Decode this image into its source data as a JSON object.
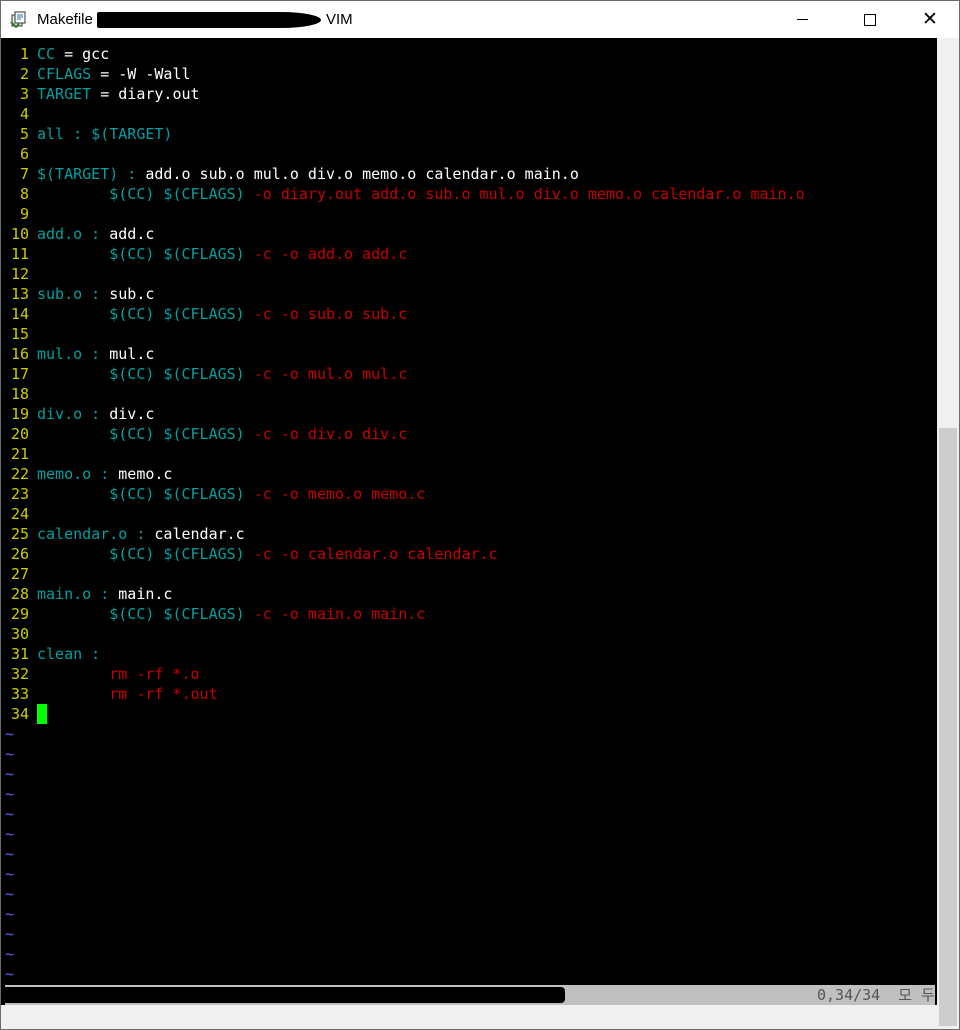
{
  "window": {
    "title": "Makefile",
    "title_suffix": "VIM",
    "controls": {
      "minimize": "—",
      "maximize": "☐",
      "close": "✕"
    }
  },
  "editor": {
    "lines": [
      {
        "n": "1",
        "segs": [
          {
            "t": "CC",
            "c": "cyan"
          },
          {
            "t": " = gcc",
            "c": "white"
          }
        ]
      },
      {
        "n": "2",
        "segs": [
          {
            "t": "CFLAGS",
            "c": "cyan"
          },
          {
            "t": " = -W -Wall",
            "c": "white"
          }
        ]
      },
      {
        "n": "3",
        "segs": [
          {
            "t": "TARGET",
            "c": "cyan"
          },
          {
            "t": " = diary.out",
            "c": "white"
          }
        ]
      },
      {
        "n": "4",
        "segs": []
      },
      {
        "n": "5",
        "segs": [
          {
            "t": "all : $(TARGET)",
            "c": "cyan"
          }
        ]
      },
      {
        "n": "6",
        "segs": []
      },
      {
        "n": "7",
        "segs": [
          {
            "t": "$(TARGET) : ",
            "c": "cyan"
          },
          {
            "t": "add.o sub.o mul.o div.o memo.o calendar.o main.o",
            "c": "white"
          }
        ]
      },
      {
        "n": "8",
        "segs": [
          {
            "t": "        ",
            "c": "white"
          },
          {
            "t": "$(CC) $(CFLAGS)",
            "c": "cyan"
          },
          {
            "t": " -o diary.out add.o sub.o mul.o div.o memo.o calendar.o main.o",
            "c": "red"
          }
        ]
      },
      {
        "n": "9",
        "segs": []
      },
      {
        "n": "10",
        "segs": [
          {
            "t": "add.o : ",
            "c": "cyan"
          },
          {
            "t": "add.c",
            "c": "white"
          }
        ]
      },
      {
        "n": "11",
        "segs": [
          {
            "t": "        ",
            "c": "white"
          },
          {
            "t": "$(CC) $(CFLAGS)",
            "c": "cyan"
          },
          {
            "t": " -c -o add.o add.c",
            "c": "red"
          }
        ]
      },
      {
        "n": "12",
        "segs": []
      },
      {
        "n": "13",
        "segs": [
          {
            "t": "sub.o : ",
            "c": "cyan"
          },
          {
            "t": "sub.c",
            "c": "white"
          }
        ]
      },
      {
        "n": "14",
        "segs": [
          {
            "t": "        ",
            "c": "white"
          },
          {
            "t": "$(CC) $(CFLAGS)",
            "c": "cyan"
          },
          {
            "t": " -c -o sub.o sub.c",
            "c": "red"
          }
        ]
      },
      {
        "n": "15",
        "segs": []
      },
      {
        "n": "16",
        "segs": [
          {
            "t": "mul.o : ",
            "c": "cyan"
          },
          {
            "t": "mul.c",
            "c": "white"
          }
        ]
      },
      {
        "n": "17",
        "segs": [
          {
            "t": "        ",
            "c": "white"
          },
          {
            "t": "$(CC) $(CFLAGS)",
            "c": "cyan"
          },
          {
            "t": " -c -o mul.o mul.c",
            "c": "red"
          }
        ]
      },
      {
        "n": "18",
        "segs": []
      },
      {
        "n": "19",
        "segs": [
          {
            "t": "div.o : ",
            "c": "cyan"
          },
          {
            "t": "div.c",
            "c": "white"
          }
        ]
      },
      {
        "n": "20",
        "segs": [
          {
            "t": "        ",
            "c": "white"
          },
          {
            "t": "$(CC) $(CFLAGS)",
            "c": "cyan"
          },
          {
            "t": " -c -o div.o div.c",
            "c": "red"
          }
        ]
      },
      {
        "n": "21",
        "segs": []
      },
      {
        "n": "22",
        "segs": [
          {
            "t": "memo.o : ",
            "c": "cyan"
          },
          {
            "t": "memo.c",
            "c": "white"
          }
        ]
      },
      {
        "n": "23",
        "segs": [
          {
            "t": "        ",
            "c": "white"
          },
          {
            "t": "$(CC) $(CFLAGS)",
            "c": "cyan"
          },
          {
            "t": " -c -o memo.o memo.c",
            "c": "red"
          }
        ]
      },
      {
        "n": "24",
        "segs": []
      },
      {
        "n": "25",
        "segs": [
          {
            "t": "calendar.o : ",
            "c": "cyan"
          },
          {
            "t": "calendar.c",
            "c": "white"
          }
        ]
      },
      {
        "n": "26",
        "segs": [
          {
            "t": "        ",
            "c": "white"
          },
          {
            "t": "$(CC) $(CFLAGS)",
            "c": "cyan"
          },
          {
            "t": " -c -o calendar.o calendar.c",
            "c": "red"
          }
        ]
      },
      {
        "n": "27",
        "segs": []
      },
      {
        "n": "28",
        "segs": [
          {
            "t": "main.o : ",
            "c": "cyan"
          },
          {
            "t": "main.c",
            "c": "white"
          }
        ]
      },
      {
        "n": "29",
        "segs": [
          {
            "t": "        ",
            "c": "white"
          },
          {
            "t": "$(CC) $(CFLAGS)",
            "c": "cyan"
          },
          {
            "t": " -c -o main.o main.c",
            "c": "red"
          }
        ]
      },
      {
        "n": "30",
        "segs": []
      },
      {
        "n": "31",
        "segs": [
          {
            "t": "clean :",
            "c": "cyan"
          }
        ]
      },
      {
        "n": "32",
        "segs": [
          {
            "t": "        ",
            "c": "white"
          },
          {
            "t": "rm -rf *.o",
            "c": "red"
          }
        ]
      },
      {
        "n": "33",
        "segs": [
          {
            "t": "        ",
            "c": "white"
          },
          {
            "t": "rm -rf *.out",
            "c": "red"
          }
        ]
      },
      {
        "n": "34",
        "segs": [],
        "cursor": true
      }
    ],
    "empty_line_marker": "~",
    "empty_line_count": 13
  },
  "status": {
    "position": "0,34/34",
    "mode": "모 두"
  },
  "colors": {
    "cyan": "#00a0a0",
    "white": "#ffffff",
    "red": "#c80000",
    "line_number": "#cdcd00",
    "tilde": "#5f5fff",
    "cursor": "#00ff00"
  }
}
